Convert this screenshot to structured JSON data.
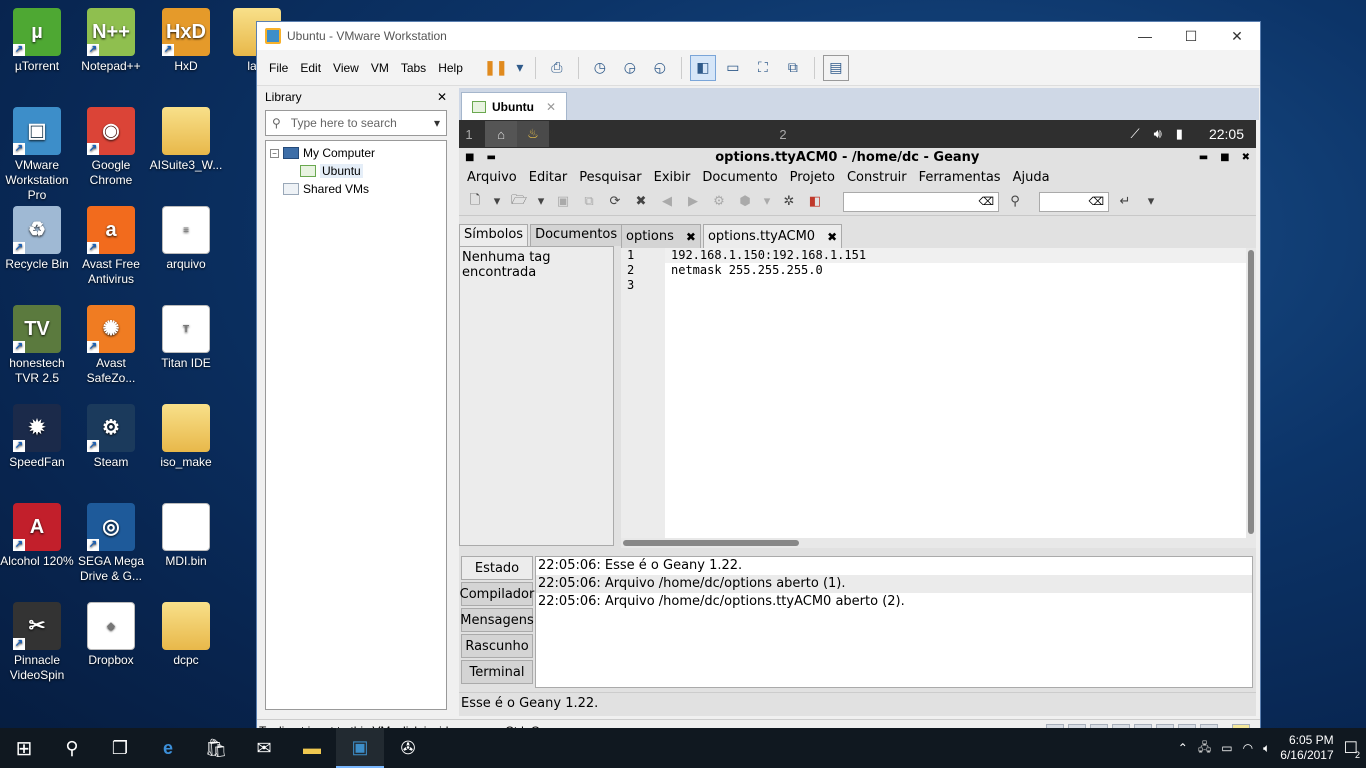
{
  "desktop": {
    "icons": [
      {
        "label": "µTorrent",
        "color": "#4ea833",
        "glyph": "µ"
      },
      {
        "label": "Notepad++",
        "color": "#8fbf4f",
        "glyph": "N++"
      },
      {
        "label": "HxD",
        "color": "#e59a2a",
        "glyph": "HxD"
      },
      {
        "label": "lant",
        "color": "#e8b84a",
        "glyph": ""
      },
      {
        "label": "VMware Workstation Pro",
        "color": "#3d8ec9",
        "glyph": "▣"
      },
      {
        "label": "Google Chrome",
        "color": "#db4437",
        "glyph": "◉"
      },
      {
        "label": "AISuite3_W...",
        "color": "#e8b84a",
        "glyph": ""
      },
      {
        "label": "Recycle Bin",
        "color": "#9fb9d4",
        "glyph": "♻"
      },
      {
        "label": "Avast Free Antivirus",
        "color": "#f26b1d",
        "glyph": "a"
      },
      {
        "label": "arquivo",
        "color": "#ffffff",
        "glyph": "≡"
      },
      {
        "label": "honestech TVR 2.5",
        "color": "#5b7a3e",
        "glyph": "TV"
      },
      {
        "label": "Avast SafeZo...",
        "color": "#f07c22",
        "glyph": "✺"
      },
      {
        "label": "Titan IDE",
        "color": "#ffffff",
        "glyph": "T"
      },
      {
        "label": "SpeedFan",
        "color": "#1b2a4a",
        "glyph": "✹"
      },
      {
        "label": "Steam",
        "color": "#1b3a5c",
        "glyph": "⚙"
      },
      {
        "label": "iso_make",
        "color": "#e8b84a",
        "glyph": ""
      },
      {
        "label": "Alcohol 120%",
        "color": "#c21f2b",
        "glyph": "A"
      },
      {
        "label": "SEGA Mega Drive & G...",
        "color": "#1e5a9a",
        "glyph": "◎"
      },
      {
        "label": "MDI.bin",
        "color": "#ffffff",
        "glyph": ""
      },
      {
        "label": "Pinnacle VideoSpin",
        "color": "#333333",
        "glyph": "✂"
      },
      {
        "label": "Dropbox",
        "color": "#ffffff",
        "glyph": "◆"
      },
      {
        "label": "dcpc",
        "color": "#e8b84a",
        "glyph": ""
      }
    ]
  },
  "vmware": {
    "title": "Ubuntu - VMware Workstation",
    "menu": [
      "File",
      "Edit",
      "View",
      "VM",
      "Tabs",
      "Help"
    ],
    "library": {
      "title": "Library",
      "close": "✕",
      "search_placeholder": "Type here to search",
      "tree": {
        "root": "My Computer",
        "child": "Ubuntu",
        "shared": "Shared VMs"
      }
    },
    "tab": {
      "label": "Ubuntu",
      "close": "✕"
    },
    "status": "To direct input to this VM, click inside or press Ctrl+G."
  },
  "ubuntu": {
    "workspaces": [
      "1",
      "2"
    ],
    "clock": "22:05"
  },
  "geany": {
    "title": "options.ttyACM0 - /home/dc - Geany",
    "menu": [
      "Arquivo",
      "Editar",
      "Pesquisar",
      "Exibir",
      "Documento",
      "Projeto",
      "Construir",
      "Ferramentas",
      "Ajuda"
    ],
    "sidebar": {
      "tabs": [
        "Símbolos",
        "Documentos"
      ],
      "content": "Nenhuma tag encontrada"
    },
    "editor": {
      "tabs": [
        {
          "label": "options",
          "close": "✖"
        },
        {
          "label": "options.ttyACM0",
          "close": "✖"
        }
      ],
      "line_numbers": [
        "1",
        "2",
        "3"
      ],
      "lines": [
        "192.168.1.150:192.168.1.151",
        "netmask 255.255.255.0",
        ""
      ]
    },
    "messages": {
      "tabs": [
        "Estado",
        "Compilador",
        "Mensagens",
        "Rascunho",
        "Terminal"
      ],
      "rows": [
        "22:05:06: Esse é o Geany 1.22.",
        "22:05:06: Arquivo /home/dc/options aberto (1).",
        "22:05:06: Arquivo /home/dc/options.ttyACM0 aberto (2)."
      ]
    },
    "status": "Esse é o Geany 1.22."
  },
  "taskbar": {
    "time": "6:05 PM",
    "date": "6/16/2017",
    "notification_count": "2"
  }
}
